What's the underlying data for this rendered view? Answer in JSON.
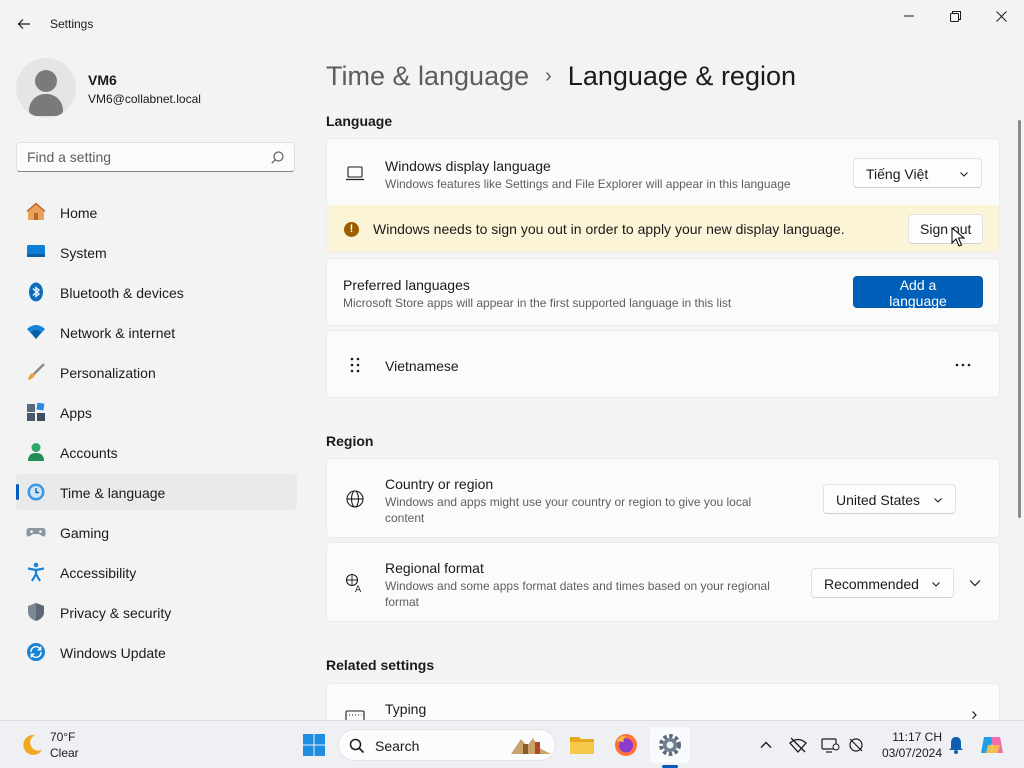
{
  "window": {
    "title": "Settings",
    "back_icon": "back-arrow-icon",
    "controls": [
      "minimize-icon",
      "maximize-icon",
      "close-icon"
    ]
  },
  "user": {
    "name": "VM6",
    "email": "VM6@collabnet.local"
  },
  "search": {
    "placeholder": "Find a setting",
    "icon": "search-icon"
  },
  "sidebar": {
    "items": [
      {
        "label": "Home",
        "icon": "home-icon",
        "selected": false
      },
      {
        "label": "System",
        "icon": "system-icon",
        "selected": false
      },
      {
        "label": "Bluetooth & devices",
        "icon": "bluetooth-icon",
        "selected": false
      },
      {
        "label": "Network & internet",
        "icon": "network-icon",
        "selected": false
      },
      {
        "label": "Personalization",
        "icon": "brush-icon",
        "selected": false
      },
      {
        "label": "Apps",
        "icon": "apps-icon",
        "selected": false
      },
      {
        "label": "Accounts",
        "icon": "accounts-icon",
        "selected": false
      },
      {
        "label": "Time & language",
        "icon": "time-language-icon",
        "selected": true
      },
      {
        "label": "Gaming",
        "icon": "gaming-icon",
        "selected": false
      },
      {
        "label": "Accessibility",
        "icon": "accessibility-icon",
        "selected": false
      },
      {
        "label": "Privacy & security",
        "icon": "shield-icon",
        "selected": false
      },
      {
        "label": "Windows Update",
        "icon": "update-icon",
        "selected": false
      }
    ]
  },
  "breadcrumb": {
    "parent": "Time & language",
    "separator": "›",
    "current": "Language & region"
  },
  "language": {
    "section_title": "Language",
    "display": {
      "title": "Windows display language",
      "description": "Windows features like Settings and File Explorer will appear in this language",
      "value": "Tiếng Việt",
      "icon": "laptop-icon"
    },
    "warning": {
      "text": "Windows needs to sign you out in order to apply your new display language.",
      "button": "Sign out",
      "icon": "warning-icon"
    },
    "preferred": {
      "title": "Preferred languages",
      "description": "Microsoft Store apps will appear in the first supported language in this list",
      "button": "Add a language"
    },
    "languages": [
      {
        "name": "Vietnamese",
        "icon": "drag-handle-icon",
        "more": "more-options-icon"
      }
    ]
  },
  "region": {
    "section_title": "Region",
    "country": {
      "title": "Country or region",
      "description_line1": "Windows and apps might use your country or region to give you local",
      "description_line2": "content",
      "value": "United States",
      "icon": "globe-icon"
    },
    "format": {
      "title": "Regional format",
      "description_line1": "Windows and some apps format dates and times based on your regional",
      "description_line2": "format",
      "value": "Recommended",
      "icon": "regional-format-icon"
    }
  },
  "related": {
    "section_title": "Related settings",
    "typing": {
      "title": "Typing",
      "icon": "keyboard-icon"
    }
  },
  "taskbar": {
    "weather": {
      "temp": "70°F",
      "condition": "Clear",
      "icon": "moon-icon"
    },
    "search_label": "Search",
    "apps": [
      "start-icon",
      "file-explorer-icon",
      "firefox-icon",
      "settings-icon"
    ],
    "tray": [
      "chevron-up-icon",
      "network-off-icon",
      "display-icon",
      "sync-icon"
    ],
    "time": "11:17 CH",
    "date": "03/07/2024",
    "colors": {
      "accent": "#005fb8",
      "warning": "#9d5d00",
      "warning_bg": "#fcf4d6"
    }
  }
}
